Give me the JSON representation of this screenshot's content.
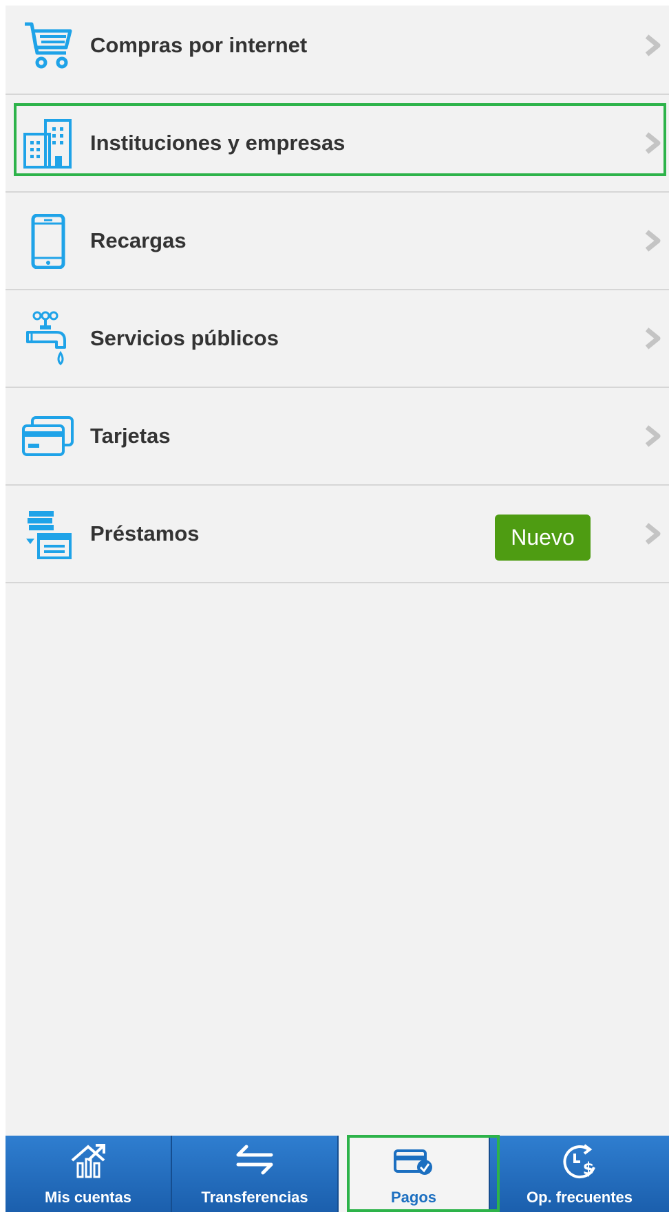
{
  "menu": {
    "items": [
      {
        "label": "Compras por internet",
        "icon": "shopping-cart-icon"
      },
      {
        "label": "Instituciones y empresas",
        "icon": "buildings-icon"
      },
      {
        "label": "Recargas",
        "icon": "smartphone-icon"
      },
      {
        "label": "Servicios públicos",
        "icon": "water-tap-icon"
      },
      {
        "label": "Tarjetas",
        "icon": "cards-icon"
      },
      {
        "label": "Préstamos",
        "icon": "loan-icon",
        "badge": "Nuevo"
      }
    ]
  },
  "bottom_nav": {
    "items": [
      {
        "label": "Mis cuentas",
        "icon": "accounts-chart-icon"
      },
      {
        "label": "Transferencias",
        "icon": "transfer-arrows-icon"
      },
      {
        "label": "Pagos",
        "icon": "payment-card-icon",
        "active": true
      },
      {
        "label": "Op. frecuentes",
        "icon": "clock-dollar-icon"
      }
    ]
  },
  "colors": {
    "accent_blue": "#1fa3e8",
    "nav_blue": "#1f6bbf",
    "badge_green": "#4e9c12",
    "highlight_green": "#2db34a",
    "background": "#f2f2f2"
  }
}
